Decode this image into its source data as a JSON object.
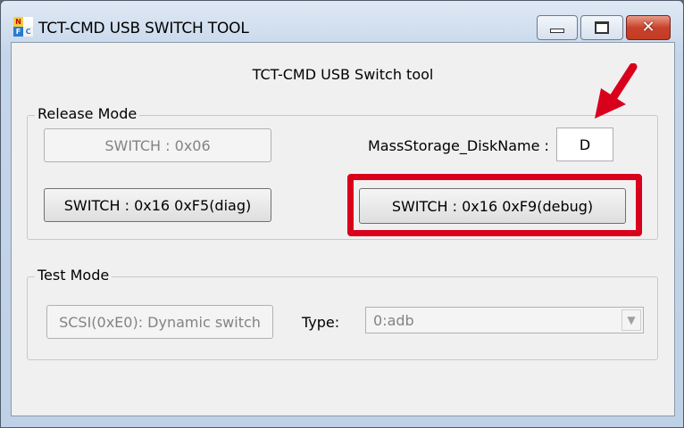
{
  "window": {
    "title": "TCT-CMD USB SWITCH TOOL",
    "icon_letters": [
      "N",
      "",
      "F",
      "C"
    ]
  },
  "heading": "TCT-CMD USB Switch tool",
  "release_mode": {
    "legend": "Release Mode",
    "switch_06_label": "SWITCH : 0x06",
    "switch_diag_label": "SWITCH : 0x16 0xF5(diag)",
    "switch_debug_label": "SWITCH : 0x16 0xF9(debug)",
    "disk_name_label": "MassStorage_DiskName :",
    "disk_name_value": "D"
  },
  "test_mode": {
    "legend": "Test Mode",
    "scsi_button_label": "SCSI(0xE0): Dynamic switch",
    "type_label": "Type:",
    "type_value": "0:adb"
  },
  "annotation": {
    "color": "#d9001b"
  },
  "icons": [
    "minimize-icon",
    "maximize-icon",
    "close-icon",
    "chevron-down-icon",
    "red-arrow-icon"
  ]
}
